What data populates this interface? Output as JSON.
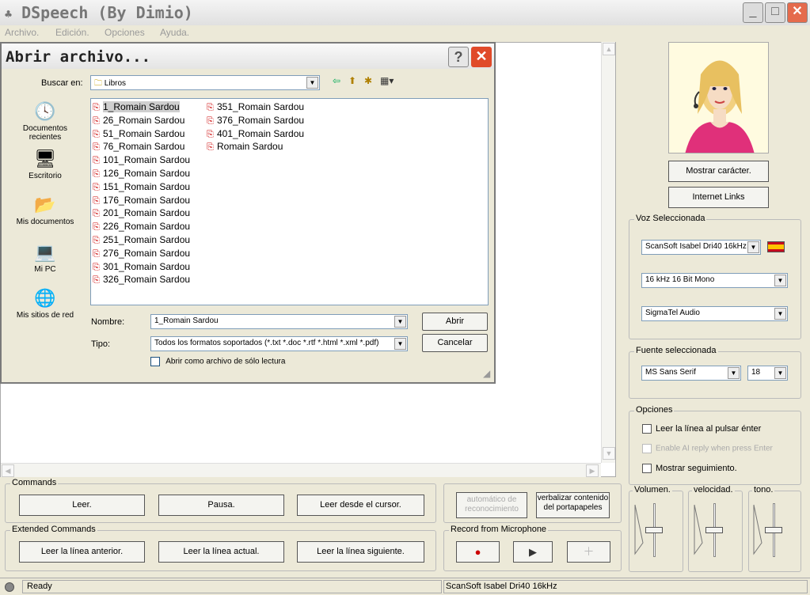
{
  "app": {
    "title": "DSpeech (By Dimio)",
    "window_buttons": {
      "minimize": "_",
      "maximize": "□",
      "close": "✕"
    }
  },
  "menu": [
    "Archivo.",
    "Edición.",
    "Opciones",
    "Ayuda."
  ],
  "dialog": {
    "title": "Abrir archivo...",
    "help": "?",
    "close": "✕",
    "look_in_label": "Buscar en:",
    "look_in_value": "Libros",
    "places": [
      {
        "label": "Documentos recientes",
        "icon": "recent-documents-icon"
      },
      {
        "label": "Escritorio",
        "icon": "desktop-icon"
      },
      {
        "label": "Mis documentos",
        "icon": "my-documents-icon"
      },
      {
        "label": "Mi PC",
        "icon": "my-computer-icon"
      },
      {
        "label": "Mis sitios de red",
        "icon": "network-places-icon"
      }
    ],
    "files_col1": [
      "1_Romain Sardou",
      "26_Romain Sardou",
      "51_Romain Sardou",
      "76_Romain Sardou",
      "101_Romain Sardou",
      "126_Romain Sardou",
      "151_Romain Sardou",
      "176_Romain Sardou",
      "201_Romain Sardou",
      "226_Romain Sardou",
      "251_Romain Sardou",
      "276_Romain Sardou",
      "301_Romain Sardou",
      "326_Romain Sardou"
    ],
    "files_col2": [
      "351_Romain Sardou",
      "376_Romain Sardou",
      "401_Romain Sardou",
      "Romain Sardou"
    ],
    "selected_file": "1_Romain Sardou",
    "name_label": "Nombre:",
    "name_value": "1_Romain Sardou",
    "type_label": "Tipo:",
    "type_value": "Todos los formatos soportados (*.txt *.doc *.rtf *.html *.xml *.pdf)",
    "readonly_label": "Abrir como archivo de sólo lectura",
    "open_button": "Abrir",
    "cancel_button": "Cancelar"
  },
  "right_panel": {
    "show_character": "Mostrar carácter.",
    "internet_links": "Internet Links",
    "voice_group": "Voz Seleccionada",
    "voice_value": "ScanSoft Isabel Dri40 16kHz",
    "format_value": "16 kHz 16 Bit Mono",
    "device_value": "SigmaTel Audio",
    "font_group": "Fuente seleccionada",
    "font_value": "MS Sans Serif",
    "font_size": "18",
    "options_group": "Opciones",
    "opt_read_line": "Leer la línea al pulsar énter",
    "opt_ai_reply": "Enable AI reply when press Enter",
    "opt_show_tracking": "Mostrar seguimiento.",
    "volume_label": "Volumen.",
    "speed_label": "velocidad.",
    "tone_label": "tono."
  },
  "commands": {
    "group_title": "Commands",
    "read": "Leer.",
    "pause": "Pausa.",
    "read_from_cursor": "Leer desde el cursor.",
    "auto_recognition": "automático de reconocimiento",
    "verbalize_clipboard": "verbalizar contenido del portapapeles"
  },
  "extended_commands": {
    "group_title": "Extended Commands",
    "prev_line": "Leer la línea anterior.",
    "current_line": "Leer la línea actual.",
    "next_line": "Leer la línea siguiente."
  },
  "record": {
    "group_title": "Record from Microphone"
  },
  "status": {
    "left": "Ready",
    "right": "ScanSoft Isabel Dri40 16kHz"
  },
  "colors": {
    "window_bg": "#ece9d8",
    "close_red": "#e04a2a",
    "pdf_red": "#cc0000",
    "flag_red": "#c60b1e",
    "flag_yellow": "#ffc400"
  }
}
